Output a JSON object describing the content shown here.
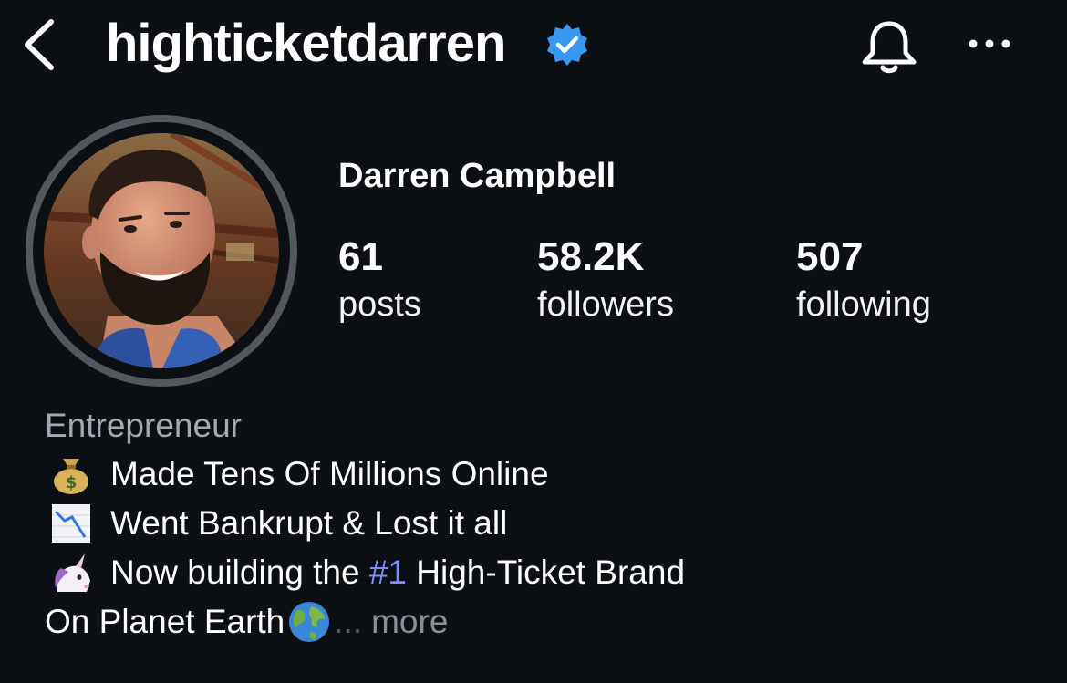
{
  "header": {
    "username": "highticketdarren",
    "verified_icon": "verified-badge-icon",
    "back_icon": "chevron-left-icon",
    "notification_icon": "bell-icon",
    "more_icon": "ellipsis-icon"
  },
  "profile": {
    "full_name": "Darren Campbell",
    "stats": [
      {
        "value": "61",
        "label": "posts"
      },
      {
        "value": "58.2K",
        "label": "followers"
      },
      {
        "value": "507",
        "label": "following"
      }
    ]
  },
  "bio": {
    "category": "Entrepreneur",
    "line1": {
      "icon": "money-bag-icon",
      "text": "Made Tens Of Millions Online"
    },
    "line2": {
      "icon": "chart-decreasing-icon",
      "text": "Went Bankrupt & Lost it all"
    },
    "line3": {
      "icon": "unicorn-icon",
      "text_before": "Now building the ",
      "hashtag": "#1",
      "text_after": " High-Ticket Brand"
    },
    "line4": {
      "text": "On Planet Earth",
      "icon": "globe-icon",
      "ellipsis": "...",
      "more": "more"
    }
  },
  "colors": {
    "background": "#0c0f14",
    "verified": "#3897f0",
    "hashtag": "#7f8cff",
    "muted_text": "#a6a9b0"
  }
}
